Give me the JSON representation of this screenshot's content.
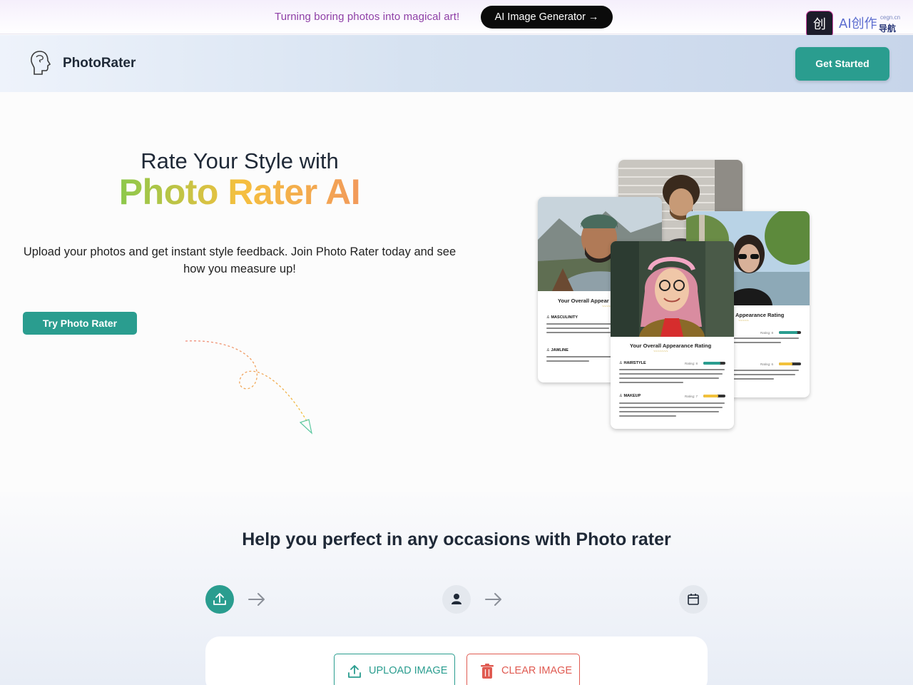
{
  "promo": {
    "text": "Turning boring photos into magical art!",
    "button": "AI Image Generator →"
  },
  "ai_badge": {
    "logo_char": "创",
    "text": "AI创作",
    "domain": "cegn.cn",
    "sub": "导航"
  },
  "header": {
    "brand": "PhotoRater",
    "cta": "Get Started"
  },
  "hero": {
    "line1": "Rate Your Style with",
    "line2": "Photo Rater AI",
    "description": "Upload your photos and get instant style feedback. Join Photo Rater today and see how you measure up!",
    "button": "Try Photo Rater"
  },
  "cards": {
    "left": {
      "title": "Your Overall Appear",
      "label1": "MASCULINITY",
      "label2": "JAWLINE"
    },
    "right": {
      "title": "ll Appearance Rating",
      "rating1": "Rating: 8",
      "rating2": "Rating: 6"
    },
    "front": {
      "title": "Your Overall Appearance Rating",
      "label1": "HAIRSTYLE",
      "rating1": "Rating: 8",
      "label2": "MAKEUP",
      "rating2": "Rating: 7"
    },
    "colors": {
      "teal": "#2a9d8f",
      "yellow": "#f2c13b"
    }
  },
  "section2": {
    "title": "Help you perfect in any occasions with Photo rater",
    "steps": [
      "upload-icon",
      "person-icon",
      "calendar-icon"
    ],
    "upload_button": "UPLOAD IMAGE",
    "clear_button": "CLEAR IMAGE"
  }
}
